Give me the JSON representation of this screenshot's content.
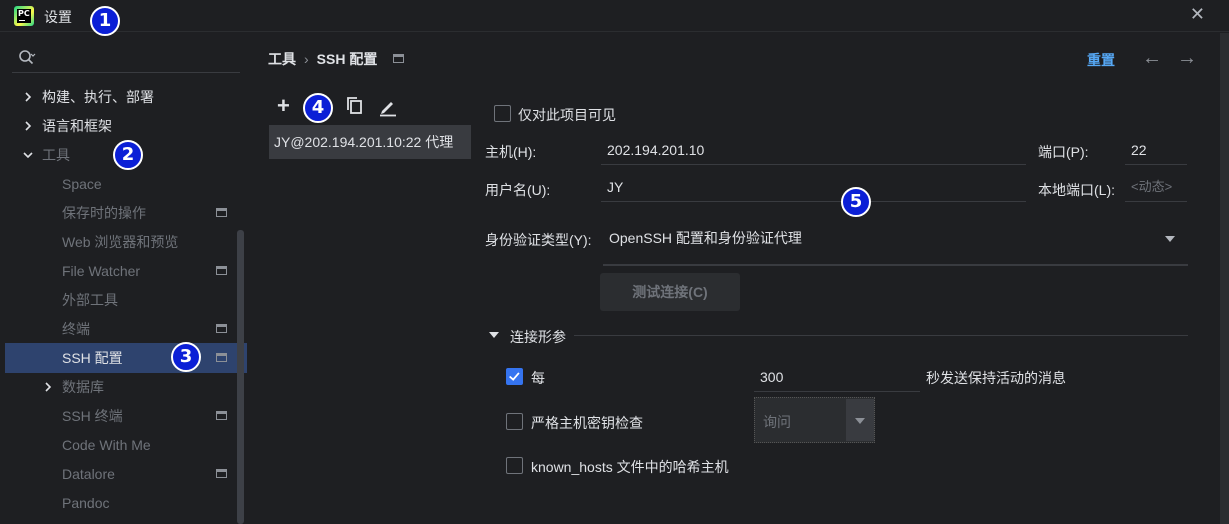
{
  "window": {
    "title": "设置",
    "logo_text": "PC"
  },
  "badges": [
    "1",
    "2",
    "3",
    "4",
    "5"
  ],
  "sidebar": {
    "search_placeholder": "",
    "items": [
      {
        "label": "构建、执行、部署",
        "expandable": true
      },
      {
        "label": "语言和框架",
        "expandable": true
      },
      {
        "label": "工具",
        "expanded": true
      },
      {
        "label": "Space"
      },
      {
        "label": "保存时的操作"
      },
      {
        "label": "Web 浏览器和预览"
      },
      {
        "label": "File Watcher"
      },
      {
        "label": "外部工具"
      },
      {
        "label": "终端"
      },
      {
        "label": "SSH 配置",
        "selected": true
      },
      {
        "label": "数据库",
        "expandable": true
      },
      {
        "label": "SSH 终端"
      },
      {
        "label": "Code With Me"
      },
      {
        "label": "Datalore"
      },
      {
        "label": "Pandoc"
      }
    ]
  },
  "header": {
    "breadcrumb_root": "工具",
    "breadcrumb_sep": "›",
    "breadcrumb_current": "SSH 配置",
    "reset_label": "重置",
    "back_icon": "←",
    "forward_icon": "→"
  },
  "toolbar": {
    "add_icon": "+",
    "copy_icon": "copy-icon",
    "edit_icon": "edit-icon"
  },
  "configs": [
    {
      "label": "JY@202.194.201.10:22 代理"
    }
  ],
  "form": {
    "visible_only_label": "仅对此项目可见",
    "host_label": "主机(H):",
    "host_value": "202.194.201.10",
    "port_label": "端口(P):",
    "port_value": "22",
    "user_label": "用户名(U):",
    "user_value": "JY",
    "local_port_label": "本地端口(L):",
    "local_port_placeholder": "<动态>",
    "auth_label": "身份验证类型(Y):",
    "auth_value": "OpenSSH 配置和身份验证代理",
    "test_button": "测试连接(C)"
  },
  "connection": {
    "section_label": "连接形参",
    "every_label": "每",
    "every_checked": true,
    "every_value": "300",
    "every_suffix": "秒发送保持活动的消息",
    "strict_label": "严格主机密钥检查",
    "strict_checked": false,
    "strict_value": "询问",
    "known_hosts_label": "known_hosts 文件中的哈希主机",
    "known_hosts_checked": false
  },
  "colors": {
    "accent": "#3574f0",
    "link": "#56a8f5",
    "badge": "#0b1fd6",
    "selection": "#2e436e",
    "background": "#1e1f22"
  }
}
